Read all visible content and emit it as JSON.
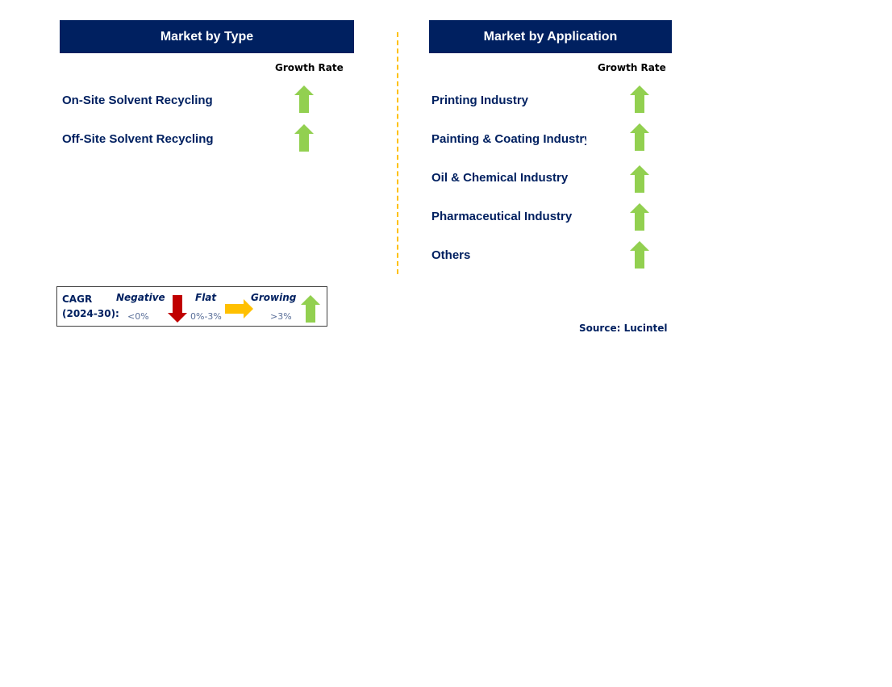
{
  "left_panel": {
    "title": "Market by Type",
    "growth_header": "Growth Rate",
    "rows": [
      {
        "label": "On-Site Solvent Recycling",
        "trend": "growing"
      },
      {
        "label": "Off-Site Solvent Recycling",
        "trend": "growing"
      }
    ]
  },
  "right_panel": {
    "title": "Market by Application",
    "growth_header": "Growth Rate",
    "rows": [
      {
        "label": "Printing Industry",
        "trend": "growing"
      },
      {
        "label": "Painting & Coating Industry",
        "trend": "growing"
      },
      {
        "label": "Oil & Chemical Industry",
        "trend": "growing"
      },
      {
        "label": "Pharmaceutical Industry",
        "trend": "growing"
      },
      {
        "label": "Others",
        "trend": "growing"
      }
    ]
  },
  "legend": {
    "cagr_label": "CAGR",
    "period_label": "(2024-30):",
    "negative": {
      "label": "Negative",
      "range": "<0%",
      "icon": "arrow-down-icon",
      "color": "#c00000"
    },
    "flat": {
      "label": "Flat",
      "range": "0%-3%",
      "icon": "arrow-right-icon",
      "color": "#ffc000"
    },
    "growing": {
      "label": "Growing",
      "range": ">3%",
      "icon": "arrow-up-icon",
      "color": "#92d050"
    }
  },
  "source": "Source: Lucintel",
  "colors": {
    "header_bg": "#002060",
    "text_primary": "#002060",
    "divider": "#ffc000",
    "growing": "#92d050"
  }
}
